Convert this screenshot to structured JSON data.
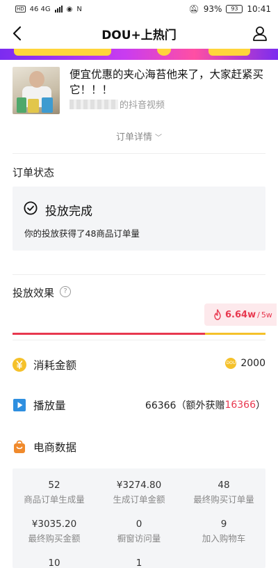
{
  "status_bar": {
    "network_left": "46 4G",
    "battery": "93%",
    "battery_level": "93",
    "time": "10:41"
  },
  "header": {
    "title": "DOU+上热门",
    "back_icon": "chevron-left-icon",
    "profile_icon": "person-icon"
  },
  "video": {
    "title": "便宜优惠的夹心海苔他来了，大家赶紧买它！！！",
    "source_suffix": "的抖音视频"
  },
  "detail_toggle": "订单详情",
  "order_status": {
    "section_title": "订单状态",
    "status": "投放完成",
    "description": "你的投放获得了48商品订单量"
  },
  "effect": {
    "section_title": "投放效果",
    "help": "?",
    "current": "6.64w",
    "target": "5w",
    "progress_fraction": 0.76
  },
  "metrics": {
    "spend": {
      "label": "消耗金额",
      "value": "2000",
      "coin": "DOU"
    },
    "plays": {
      "label": "播放量",
      "value": "66366（额外获赠",
      "bonus": "16366",
      "close": "）"
    }
  },
  "ecommerce": {
    "section_title": "电商数据",
    "cells": [
      {
        "value": "52",
        "label": "商品订单生成量"
      },
      {
        "value": "¥3274.80",
        "label": "生成订单金额"
      },
      {
        "value": "48",
        "label": "最终购买订单量"
      },
      {
        "value": "¥3035.20",
        "label": "最终购买金额"
      },
      {
        "value": "0",
        "label": "橱窗访问量"
      },
      {
        "value": "9",
        "label": "加入购物车"
      },
      {
        "value": "10",
        "label": ""
      },
      {
        "value": "1",
        "label": ""
      }
    ]
  },
  "colors": {
    "accent_red": "#e8384f",
    "accent_yellow": "#f5c12a",
    "card_bg": "#f4f5f7"
  }
}
